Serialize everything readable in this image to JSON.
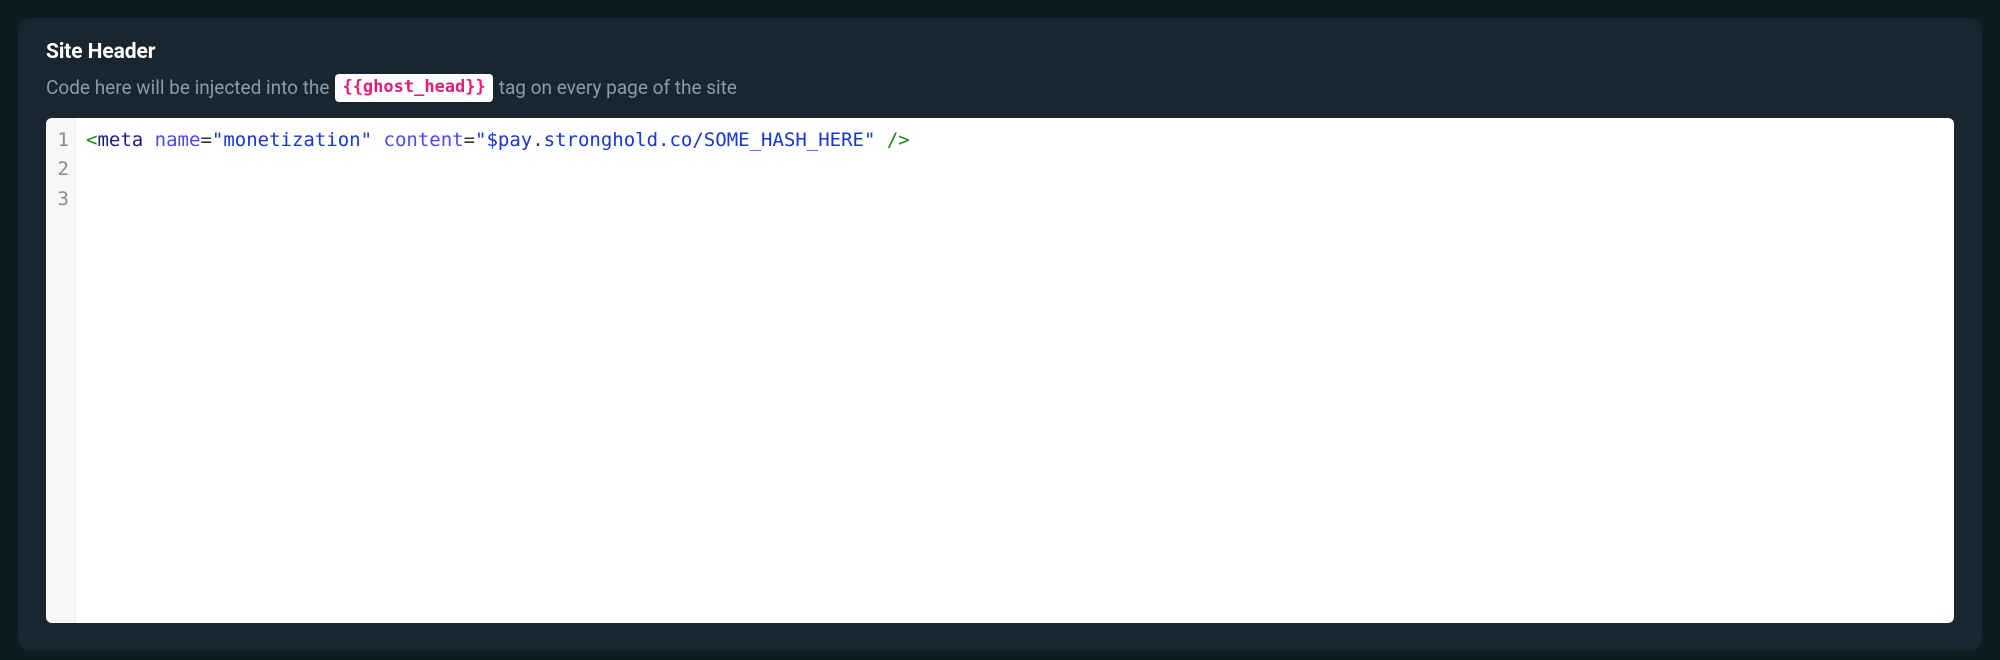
{
  "header": {
    "title": "Site Header",
    "subtitle_before": "Code here will be injected into the",
    "code_tag": "{{ghost_head}}",
    "subtitle_after": "tag on every page of the site"
  },
  "editor": {
    "line_numbers": [
      "1",
      "2",
      "3"
    ],
    "lines": [
      {
        "tokens": [
          {
            "cls": "tok-bracket",
            "text": "<"
          },
          {
            "cls": "tok-tag",
            "text": "meta"
          },
          {
            "cls": "plain",
            "text": " "
          },
          {
            "cls": "tok-attr",
            "text": "name"
          },
          {
            "cls": "tok-eq",
            "text": "="
          },
          {
            "cls": "tok-str",
            "text": "\"monetization\""
          },
          {
            "cls": "plain",
            "text": " "
          },
          {
            "cls": "tok-attr",
            "text": "content"
          },
          {
            "cls": "tok-eq",
            "text": "="
          },
          {
            "cls": "tok-str",
            "text": "\"$pay.stronghold.co/SOME_HASH_HERE\""
          },
          {
            "cls": "plain",
            "text": " "
          },
          {
            "cls": "tok-selfclose",
            "text": "/>"
          }
        ]
      },
      {
        "tokens": []
      },
      {
        "tokens": []
      }
    ]
  }
}
